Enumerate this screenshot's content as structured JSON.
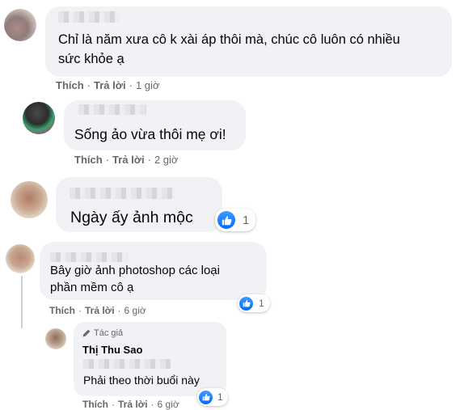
{
  "comments": [
    {
      "text_lines": [
        "Chỉ là năm xưa cô k xài áp thôi mà, chúc cô luôn có nhiều",
        "sức khỏe ạ"
      ],
      "actions": {
        "like": "Thích",
        "reply": "Trả lời",
        "sep": "·",
        "time": "1 giờ"
      }
    },
    {
      "text_lines": [
        "Sống ảo vừa thôi mẹ ơi!"
      ],
      "actions": {
        "like": "Thích",
        "reply": "Trả lời",
        "sep": "·",
        "time": "2 giờ"
      }
    },
    {
      "text_lines": [
        "Ngày ấy ảnh mộc"
      ],
      "reactions": "1"
    },
    {
      "text_lines": [
        "Bây giờ ảnh photoshop các loại",
        "phần mềm cô ạ"
      ],
      "actions": {
        "like": "Thích",
        "reply": "Trả lời",
        "sep": "·",
        "time": "6 giờ"
      },
      "reactions": "1"
    },
    {
      "author_badge": "Tác giả",
      "author_name": "Thị Thu Sao",
      "text_lines": [
        "Phải theo thời buổi này"
      ],
      "actions": {
        "like": "Thích",
        "reply": "Trả lời",
        "sep": "·",
        "time": "6 giờ"
      },
      "reactions": "1"
    }
  ],
  "icons": {
    "like": "thumbs-up-icon",
    "author": "pencil-icon"
  },
  "colors": {
    "bubble": "#f0f2f5",
    "like_blue": "#0866ff",
    "meta_gray": "#65676b",
    "text": "#050505"
  }
}
